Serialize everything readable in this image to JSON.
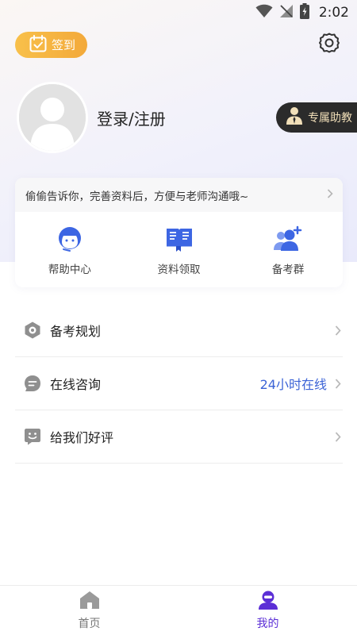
{
  "status_bar": {
    "time": "2:02"
  },
  "header": {
    "checkin_label": "签到",
    "login_label": "登录/注册",
    "tutor_label": "专属助教"
  },
  "card": {
    "tip_text": "偷偷告诉你，完善资料后，方便与老师沟通哦~",
    "quick_items": [
      {
        "label": "帮助中心",
        "icon": "headset-icon"
      },
      {
        "label": "资料领取",
        "icon": "book-icon"
      },
      {
        "label": "备考群",
        "icon": "group-add-icon"
      }
    ]
  },
  "menu": [
    {
      "label": "备考规划",
      "icon": "target-icon",
      "extra": ""
    },
    {
      "label": "在线咨询",
      "icon": "chat-icon",
      "extra": "24小时在线"
    },
    {
      "label": "给我们好评",
      "icon": "smile-icon",
      "extra": ""
    }
  ],
  "bottom_nav": {
    "home_label": "首页",
    "mine_label": "我的",
    "active": "mine"
  },
  "colors": {
    "accent": "#5b2ed6",
    "quick_icon": "#3d66e3",
    "checkin_orange": "#f3a93a",
    "link_blue": "#3b63d6"
  }
}
